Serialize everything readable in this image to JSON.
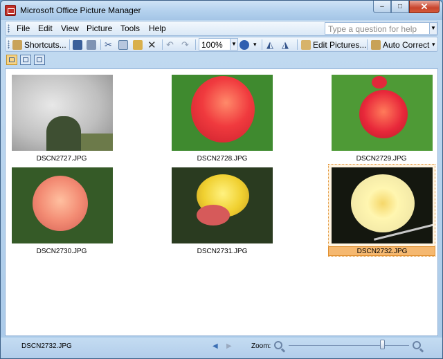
{
  "window": {
    "title": "Microsoft Office Picture Manager",
    "minimize": "–",
    "maximize": "□",
    "close": "✕"
  },
  "menu": {
    "items": [
      {
        "label": "File"
      },
      {
        "label": "Edit"
      },
      {
        "label": "View"
      },
      {
        "label": "Picture"
      },
      {
        "label": "Tools"
      },
      {
        "label": "Help"
      }
    ],
    "help_placeholder": "Type a question for help"
  },
  "toolbar": {
    "shortcuts_label": "Shortcuts...",
    "zoom_value": "100%",
    "edit_pictures_label": "Edit Pictures...",
    "auto_correct_label": "Auto Correct"
  },
  "thumbnails": [
    {
      "filename": "DSCN2727.JPG",
      "selected": false
    },
    {
      "filename": "DSCN2728.JPG",
      "selected": false
    },
    {
      "filename": "DSCN2729.JPG",
      "selected": false
    },
    {
      "filename": "DSCN2730.JPG",
      "selected": false
    },
    {
      "filename": "DSCN2731.JPG",
      "selected": false
    },
    {
      "filename": "DSCN2732.JPG",
      "selected": true
    }
  ],
  "status": {
    "current_file": "DSCN2732.JPG",
    "zoom_label": "Zoom:",
    "zoom_level": 0.78
  },
  "colors": {
    "selection": "#f5b870",
    "accent": "#3b5f86"
  }
}
